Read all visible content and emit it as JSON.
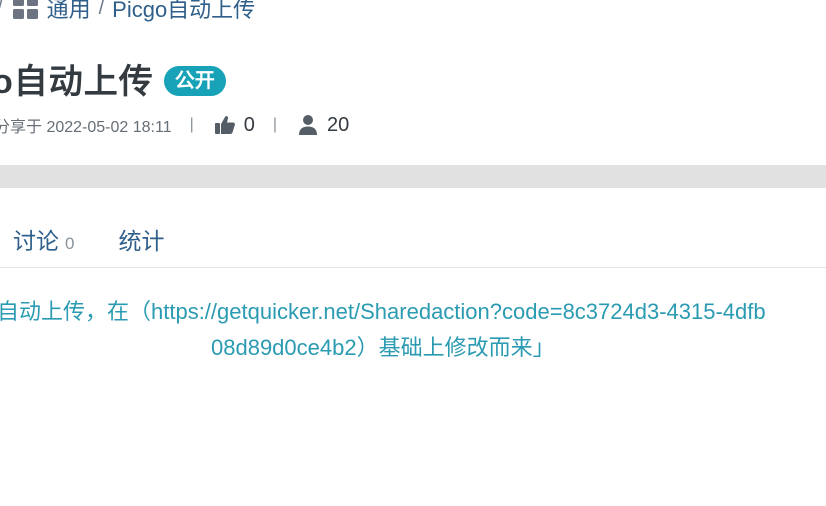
{
  "breadcrumb": {
    "leading_sep": "/",
    "category": "通用",
    "sep": "/",
    "current": "Picgo自动上传"
  },
  "header": {
    "title": "o自动上传",
    "badge": "公开"
  },
  "meta": {
    "shared": "分享于 2022-05-02 18:11",
    "sep": "|",
    "likes": "0",
    "users": "20"
  },
  "tabs": [
    {
      "label": "讨论",
      "count": "0"
    },
    {
      "label": "统计"
    }
  ],
  "description": {
    "line1": "自动上传，在（https://getquicker.net/Sharedaction?code=8c3724d3-4315-4dfb",
    "line2": "08d89d0ce4b2）基础上修改而来」"
  },
  "colors": {
    "badge": "#17a2b8",
    "link": "#2f5f8a",
    "description": "#2a9bb2",
    "gray_bar": "#e1e1e1"
  }
}
